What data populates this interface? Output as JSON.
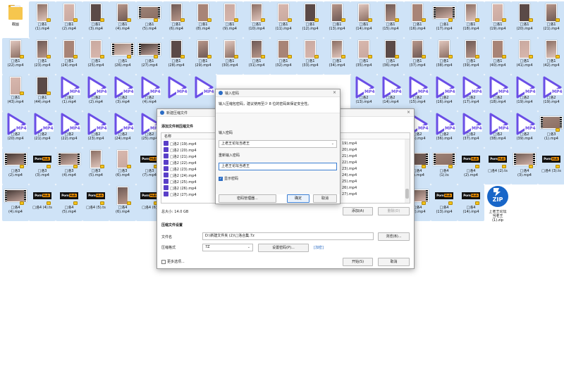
{
  "desktop": {
    "items": [
      {
        "label": "截图",
        "kind": "folder",
        "col": 0,
        "row": 0
      },
      {
        "label": "□洛1\n(1).mp4",
        "kind": "portrait",
        "col": 1,
        "row": 0
      },
      {
        "label": "□洛1\n(2).mp4",
        "kind": "portrait",
        "col": 2,
        "row": 0
      },
      {
        "label": "□洛1\n(3).mp4",
        "kind": "portrait",
        "col": 3,
        "row": 0
      },
      {
        "label": "□洛1\n(4).mp4",
        "kind": "portrait",
        "col": 4,
        "row": 0
      },
      {
        "label": "□洛1\n(5).mp4",
        "kind": "strip",
        "col": 5,
        "row": 0
      },
      {
        "label": "□洛1\n(6).mp4",
        "kind": "portrait",
        "col": 6,
        "row": 0
      },
      {
        "label": "□洛1\n(8).mp4",
        "kind": "portrait",
        "col": 7,
        "row": 0
      },
      {
        "label": "□洛1\n(9).mp4",
        "kind": "portrait",
        "col": 8,
        "row": 0
      },
      {
        "label": "□洛1\n(10).mp4",
        "kind": "portrait",
        "col": 9,
        "row": 0
      },
      {
        "label": "□洛1\n(11).mp4",
        "kind": "portrait",
        "col": 10,
        "row": 0
      },
      {
        "label": "□洛1\n(12).mp4",
        "kind": "portrait",
        "col": 11,
        "row": 0
      },
      {
        "label": "□洛1\n(13).mp4",
        "kind": "portrait",
        "col": 12,
        "row": 0
      },
      {
        "label": "□洛1\n(14).mp4",
        "kind": "portrait",
        "col": 13,
        "row": 0
      },
      {
        "label": "□洛1\n(15).mp4",
        "kind": "portrait",
        "col": 14,
        "row": 0
      },
      {
        "label": "□洛1\n(16).mp4",
        "kind": "portrait",
        "col": 15,
        "row": 0
      },
      {
        "label": "□洛1\n(17).mp4",
        "kind": "strip",
        "col": 16,
        "row": 0
      },
      {
        "label": "□洛1\n(18).mp4",
        "kind": "portrait",
        "col": 17,
        "row": 0
      },
      {
        "label": "□洛1\n(19).mp4",
        "kind": "portrait",
        "col": 18,
        "row": 0
      },
      {
        "label": "□洛1\n(20).mp4",
        "kind": "portrait",
        "col": 19,
        "row": 0
      },
      {
        "label": "□洛1\n(21).mp4",
        "kind": "portrait",
        "col": 20,
        "row": 0
      },
      {
        "label": "□洛1\n(22).mp4",
        "kind": "portrait",
        "col": 0,
        "row": 1
      },
      {
        "label": "□洛1\n(23).mp4",
        "kind": "portrait",
        "col": 1,
        "row": 1
      },
      {
        "label": "□洛1\n(24).mp4",
        "kind": "portrait",
        "col": 2,
        "row": 1
      },
      {
        "label": "□洛1\n(25).mp4",
        "kind": "portrait",
        "col": 3,
        "row": 1
      },
      {
        "label": "□洛1\n(26).mp4",
        "kind": "strip",
        "col": 4,
        "row": 1
      },
      {
        "label": "□洛1\n(27).mp4",
        "kind": "strip",
        "col": 5,
        "row": 1
      },
      {
        "label": "□洛1\n(28).mp4",
        "kind": "portrait",
        "col": 6,
        "row": 1
      },
      {
        "label": "□洛1\n(29).mp4",
        "kind": "portrait",
        "col": 7,
        "row": 1
      },
      {
        "label": "□洛1\n(30).mp4",
        "kind": "portrait",
        "col": 8,
        "row": 1
      },
      {
        "label": "□洛1\n(31).mp4",
        "kind": "portrait",
        "col": 9,
        "row": 1
      },
      {
        "label": "□洛1\n(32).mp4",
        "kind": "portrait",
        "col": 10,
        "row": 1
      },
      {
        "label": "□洛1\n(33).mp4",
        "kind": "portrait",
        "col": 11,
        "row": 1
      },
      {
        "label": "□洛1\n(34).mp4",
        "kind": "portrait",
        "col": 12,
        "row": 1
      },
      {
        "label": "□洛1\n(35).mp4",
        "kind": "portrait",
        "col": 13,
        "row": 1
      },
      {
        "label": "□洛1\n(36).mp4",
        "kind": "portrait",
        "col": 14,
        "row": 1
      },
      {
        "label": "□洛1\n(37).mp4",
        "kind": "portrait",
        "col": 15,
        "row": 1
      },
      {
        "label": "□洛1\n(38).mp4",
        "kind": "portrait",
        "col": 16,
        "row": 1
      },
      {
        "label": "□洛1\n(39).mp4",
        "kind": "portrait",
        "col": 17,
        "row": 1
      },
      {
        "label": "□洛1\n(40).mp4",
        "kind": "portrait",
        "col": 18,
        "row": 1
      },
      {
        "label": "□洛1\n(41).mp4",
        "kind": "portrait",
        "col": 19,
        "row": 1
      },
      {
        "label": "□洛1\n(42).mp4",
        "kind": "portrait",
        "col": 20,
        "row": 1
      },
      {
        "label": "□洛1\n(43).mp4",
        "kind": "portrait",
        "col": 0,
        "row": 2
      },
      {
        "label": "□洛1\n(44).mp4",
        "kind": "portrait",
        "col": 1,
        "row": 2
      },
      {
        "label": "□洛2\n(1).mp4",
        "kind": "play",
        "col": 2,
        "row": 2
      },
      {
        "label": "□洛2\n(2).mp4",
        "kind": "play",
        "col": 3,
        "row": 2
      },
      {
        "label": "□洛2\n(3).mp4",
        "kind": "play",
        "col": 4,
        "row": 2
      },
      {
        "label": "□洛2\n(4).mp4",
        "kind": "play",
        "col": 5,
        "row": 2
      },
      {
        "label": "",
        "kind": "play",
        "col": 6,
        "row": 2
      },
      {
        "label": "",
        "kind": "play",
        "col": 7,
        "row": 2
      },
      {
        "label": "□洛2\n(13).mp4",
        "kind": "play",
        "col": 13,
        "row": 2
      },
      {
        "label": "□洛2\n(14).mp4",
        "kind": "play",
        "col": 14,
        "row": 2
      },
      {
        "label": "□洛2\n(15).mp4",
        "kind": "play",
        "col": 15,
        "row": 2
      },
      {
        "label": "□洛2\n(16).mp4",
        "kind": "play",
        "col": 16,
        "row": 2
      },
      {
        "label": "□洛2\n(17).mp4",
        "kind": "play",
        "col": 17,
        "row": 2
      },
      {
        "label": "□洛2\n(18).mp4",
        "kind": "play",
        "col": 18,
        "row": 2
      },
      {
        "label": "□洛2\n(19).mp4",
        "kind": "play",
        "col": 19,
        "row": 2
      },
      {
        "label": "□洛2\n(19).mp4",
        "kind": "play",
        "col": 20,
        "row": 2
      },
      {
        "label": "□洛2\n(20).mp4",
        "kind": "play",
        "col": 0,
        "row": 3
      },
      {
        "label": "□洛2\n(21).mp4",
        "kind": "play",
        "col": 1,
        "row": 3
      },
      {
        "label": "□洛2\n(22).mp4",
        "kind": "play",
        "col": 2,
        "row": 3
      },
      {
        "label": "□洛2\n(23).mp4",
        "kind": "play",
        "col": 3,
        "row": 3
      },
      {
        "label": "□洛2\n(24).mp4",
        "kind": "play",
        "col": 4,
        "row": 3
      },
      {
        "label": "□洛2\n(25).mp4",
        "kind": "play",
        "col": 5,
        "row": 3
      },
      {
        "label": "□洛2\n(35).mp4",
        "kind": "play",
        "col": 15,
        "row": 3
      },
      {
        "label": "□洛2\n(36).mp4",
        "kind": "play",
        "col": 16,
        "row": 3
      },
      {
        "label": "□洛2\n(37).mp4",
        "kind": "play",
        "col": 17,
        "row": 3
      },
      {
        "label": "□洛2\n(38).mp4",
        "kind": "play",
        "col": 18,
        "row": 3
      },
      {
        "label": "□洛2\n(39).mp4",
        "kind": "play",
        "col": 19,
        "row": 3
      },
      {
        "label": "□洛3\n(1).mp4",
        "kind": "strip",
        "col": 20,
        "row": 3
      },
      {
        "label": "□洛3\n(2).mp4",
        "kind": "strip",
        "col": 0,
        "row": 4
      },
      {
        "label": "□洛3\n(3).mp4",
        "kind": "ph",
        "col": 1,
        "row": 4
      },
      {
        "label": "□洛3\n(4).mp4",
        "kind": "strip",
        "col": 2,
        "row": 4
      },
      {
        "label": "□洛3\n(5).mp4",
        "kind": "portrait",
        "col": 3,
        "row": 4
      },
      {
        "label": "□洛3\n(6).mp4",
        "kind": "portrait",
        "col": 4,
        "row": 4
      },
      {
        "label": "□洛3\n(7).mp4",
        "kind": "ph",
        "col": 5,
        "row": 4
      },
      {
        "label": "□洛4\n(1).mp4",
        "kind": "strip",
        "col": 15,
        "row": 4
      },
      {
        "label": "□洛4\n(1).ts",
        "kind": "strip",
        "col": 16,
        "row": 4
      },
      {
        "label": "□洛4\n(2).mp4",
        "kind": "ph",
        "col": 17,
        "row": 4
      },
      {
        "label": "□洛4 (2).ts",
        "kind": "ph",
        "col": 18,
        "row": 4
      },
      {
        "label": "□洛4\n(3).mp4",
        "kind": "strip",
        "col": 19,
        "row": 4
      },
      {
        "label": "□洛4 (3).ts",
        "kind": "ph",
        "col": 20,
        "row": 4
      },
      {
        "label": "□洛4\n(4).mp4",
        "kind": "strip",
        "col": 0,
        "row": 5
      },
      {
        "label": "□洛4 (4).ts",
        "kind": "ph",
        "col": 1,
        "row": 5
      },
      {
        "label": "□洛4\n(5).mp4",
        "kind": "ph",
        "col": 2,
        "row": 5
      },
      {
        "label": "□洛4 (5).ts",
        "kind": "ph",
        "col": 3,
        "row": 5
      },
      {
        "label": "□洛4\n(6).mp4",
        "kind": "portrait",
        "col": 4,
        "row": 5
      },
      {
        "label": "□洛4 (6)",
        "kind": "ph",
        "col": 5,
        "row": 5
      },
      {
        "label": "□洛4\n(12).mp4",
        "kind": "strip",
        "col": 15,
        "row": 5
      },
      {
        "label": "□洛4\n(13).mp4",
        "kind": "ph",
        "col": 16,
        "row": 5
      },
      {
        "label": "□洛4\n(14).mp4",
        "kind": "ph",
        "col": 17,
        "row": 5
      },
      {
        "label": "上老王论坛\n当老王\n(1).zip",
        "kind": "zip",
        "col": 18,
        "row": 5
      }
    ],
    "ph_text": "Porn",
    "ph_hub": "Hub",
    "play_glyph": "MP4",
    "zip_text": "ZIP",
    "colors": {
      "selection": "#cfe3f7",
      "play_purple": "#6a4ee6",
      "zip_blue": "#1866c8"
    }
  },
  "create_dialog": {
    "title": "新建压缩文件",
    "close_glyph": "×",
    "section_add": "添加文件到压缩文件",
    "list_header_name": "名称",
    "files": [
      "□洛2 (19).mp4",
      "□洛2 (20).mp4",
      "□洛2 (21).mp4",
      "□洛2 (22).mp4",
      "□洛2 (23).mp4",
      "□洛2 (24).mp4",
      "□洛2 (25).mp4",
      "□洛2 (26).mp4",
      "□洛2 (27).mp4"
    ],
    "files_right": [
      "19).mp4",
      "20).mp4",
      "21).mp4",
      "22).mp4",
      "23).mp4",
      "24).mp4",
      "25).mp4",
      "26).mp4",
      "27).mp4"
    ],
    "total_size": "总大小: 14.0 GB",
    "add_button": "添加(A)",
    "delete_button": "删除(D)",
    "section_settings": "压缩文件设置",
    "filename_label": "文件名",
    "filename_value": "D:\\新建文件夹 (2)\\□洛合集.7z",
    "browse_button": "浏览(B)...",
    "format_label": "压缩格式",
    "format_value": "7Z",
    "set_password_button": "设置密码(P)...",
    "encrypted_tag": "[加密]",
    "more_options": "更多选项...",
    "start_button": "开始(S)",
    "cancel_button": "取消"
  },
  "password_dialog": {
    "title": "输入密码",
    "close_glyph": "×",
    "hint": "输入压缩包密码，建议使用至少 8 位的密码来保证安全性。",
    "password_label": "输入密码",
    "password_value": "上老王论坛当老王",
    "repeat_label": "重新输入密码",
    "repeat_value": "上老王论坛当老王",
    "show_password": "显示密码",
    "manage_button": "密码管理器...",
    "ok_button": "确定",
    "cancel_button": "取消"
  }
}
